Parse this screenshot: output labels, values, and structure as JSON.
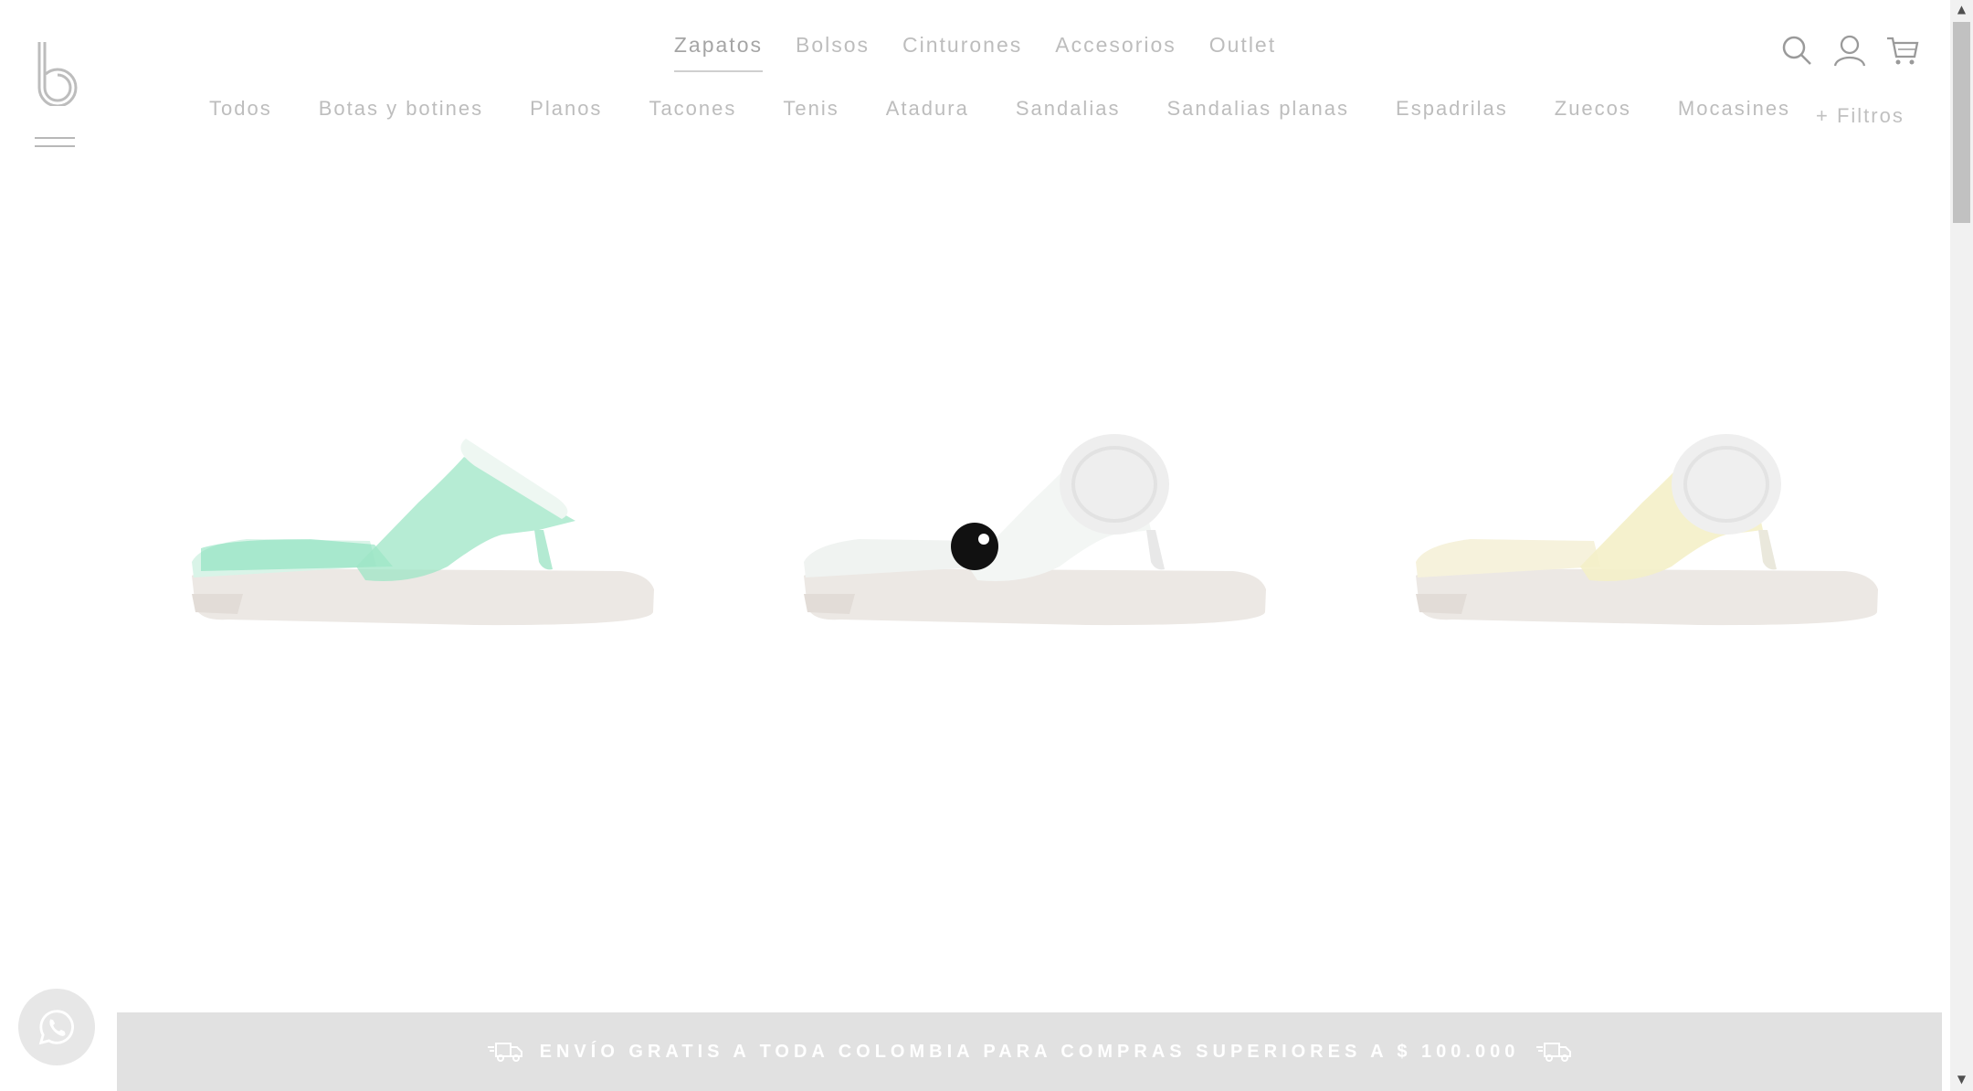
{
  "logo": {
    "icon": "brand-b-logo-icon"
  },
  "menu": {
    "icon": "hamburger-icon"
  },
  "top_nav": [
    {
      "label": "Zapatos",
      "active": true
    },
    {
      "label": "Bolsos",
      "active": false
    },
    {
      "label": "Cinturones",
      "active": false
    },
    {
      "label": "Accesorios",
      "active": false
    },
    {
      "label": "Outlet",
      "active": false
    }
  ],
  "sub_nav": [
    {
      "label": "Todos"
    },
    {
      "label": "Botas y botines"
    },
    {
      "label": "Planos"
    },
    {
      "label": "Tacones"
    },
    {
      "label": "Tenis"
    },
    {
      "label": "Atadura"
    },
    {
      "label": "Sandalias"
    },
    {
      "label": "Sandalias planas"
    },
    {
      "label": "Espadrilas"
    },
    {
      "label": "Zuecos"
    },
    {
      "label": "Mocasines"
    }
  ],
  "filters": {
    "label": "+ Filtros"
  },
  "header_icons": [
    "search-icon",
    "user-icon",
    "cart-icon"
  ],
  "products": [
    {
      "name": "product-sandal-green",
      "color": "#8fe0bd"
    },
    {
      "name": "product-sandal-white",
      "color": "#f4f6f4"
    },
    {
      "name": "product-sandal-cream",
      "color": "#f4efc8"
    }
  ],
  "banner": {
    "text": "ENVÍO GRATIS A TODA COLOMBIA PARA COMPRAS SUPERIORES A $ 100.000",
    "icon": "delivery-truck-icon"
  },
  "whatsapp": {
    "icon": "whatsapp-icon"
  },
  "colors": {
    "nav_text": "#bdbdbd",
    "banner_bg": "#e1e1e1",
    "banner_text": "#ffffff",
    "cursor_dot": "#111111"
  }
}
